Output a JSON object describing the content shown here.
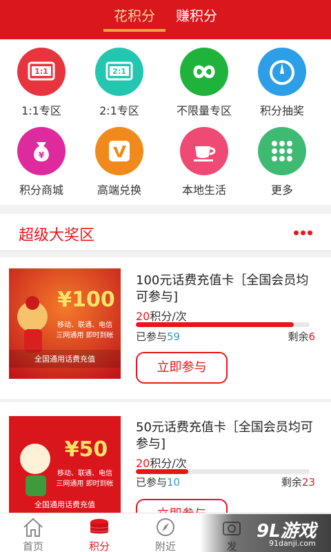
{
  "header": {
    "tabs": [
      {
        "label": "花积分",
        "active": true
      },
      {
        "label": "赚积分",
        "active": false
      }
    ]
  },
  "grid": {
    "items": [
      {
        "label": "1:1专区",
        "icon": "1-to-1-ticket-icon",
        "color": "#e6353f",
        "badge": "1:1"
      },
      {
        "label": "2:1专区",
        "icon": "2-to-1-ticket-icon",
        "color": "#25c6b0",
        "badge": "2:1"
      },
      {
        "label": "不限量专区",
        "icon": "infinity-icon",
        "color": "#1fb33c"
      },
      {
        "label": "积分抽奖",
        "icon": "dial-icon",
        "color": "#2d9ee8"
      },
      {
        "label": "积分商城",
        "icon": "money-bag-icon",
        "color": "#de2a9c"
      },
      {
        "label": "高端兑换",
        "icon": "v-badge-icon",
        "color": "#f18a1c"
      },
      {
        "label": "本地生活",
        "icon": "coffee-cup-icon",
        "color": "#ef4a74"
      },
      {
        "label": "更多",
        "icon": "grid-dots-icon",
        "color": "#3fba72"
      }
    ]
  },
  "section": {
    "title": "超级大奖区"
  },
  "products": [
    {
      "title": "100元话费充值卡［全国会员均可参与]",
      "price_num": "20",
      "price_unit": "积分/次",
      "progress": 0.91,
      "joined_label": "已参与",
      "joined_num": "59",
      "remain_label": "剩余",
      "remain_num": "6",
      "button": "立即参与",
      "thumb": {
        "amount": "¥100",
        "line1": "移动、联通、电信",
        "line2": "三网通用 即时到帐",
        "footer": "全国通用话费充值"
      }
    },
    {
      "title": "50元话费充值卡［全国会员均可参与]",
      "price_num": "20",
      "price_unit": "积分/次",
      "progress": 0.3,
      "joined_label": "已参与",
      "joined_num": "10",
      "remain_label": "剩余",
      "remain_num": "23",
      "button": "立即参与",
      "thumb": {
        "amount": "¥50",
        "line1": "移动、联通、电信",
        "line2": "三网通用 即时到帐",
        "footer": "全国通用话费充值"
      }
    }
  ],
  "bottom_nav": [
    {
      "label": "首页",
      "icon": "home-icon",
      "active": false
    },
    {
      "label": "积分",
      "icon": "coins-icon",
      "active": true
    },
    {
      "label": "附近",
      "icon": "compass-icon",
      "active": false
    },
    {
      "label": "发",
      "icon": "camera-icon",
      "active": false
    }
  ],
  "watermark": {
    "logo": "9L游戏",
    "url": "91danji.com"
  },
  "colors": {
    "brand": "#d9171c",
    "accent": "#e8151b",
    "highlight": "#f2a444",
    "link": "#3399cc"
  }
}
